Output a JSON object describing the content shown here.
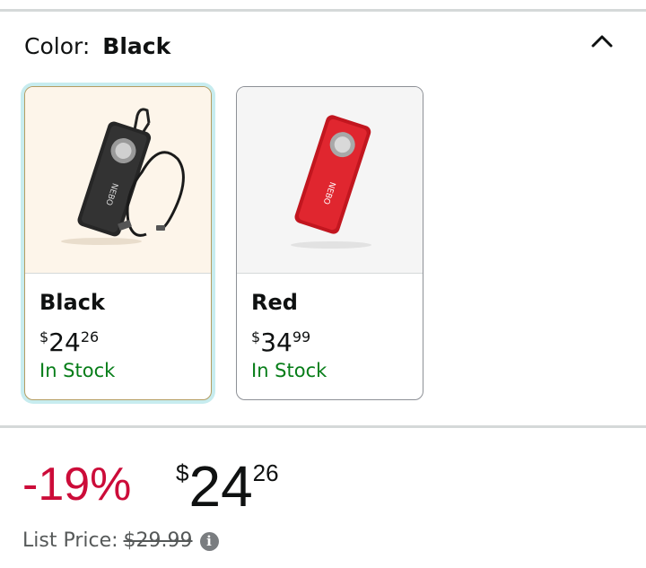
{
  "color_selector": {
    "label": "Color:",
    "selected": "Black",
    "chevron_icon": "chevron-up-icon"
  },
  "swatches": [
    {
      "name": "Black",
      "price_currency": "$",
      "price_whole": "24",
      "price_fraction": "26",
      "availability": "In Stock",
      "selected": true,
      "product_color": "#2b2b2b"
    },
    {
      "name": "Red",
      "price_currency": "$",
      "price_whole": "34",
      "price_fraction": "99",
      "availability": "In Stock",
      "selected": false,
      "product_color": "#d4202b"
    }
  ],
  "pricing": {
    "discount": "-19%",
    "currency": "$",
    "price_whole": "24",
    "price_fraction": "26",
    "list_price_label": "List Price:",
    "list_price": "$29.99",
    "info_icon": "info-icon"
  },
  "colors": {
    "discount": "#cc0c39",
    "in_stock": "#067d18",
    "selected_ring": "#c7ecef"
  }
}
